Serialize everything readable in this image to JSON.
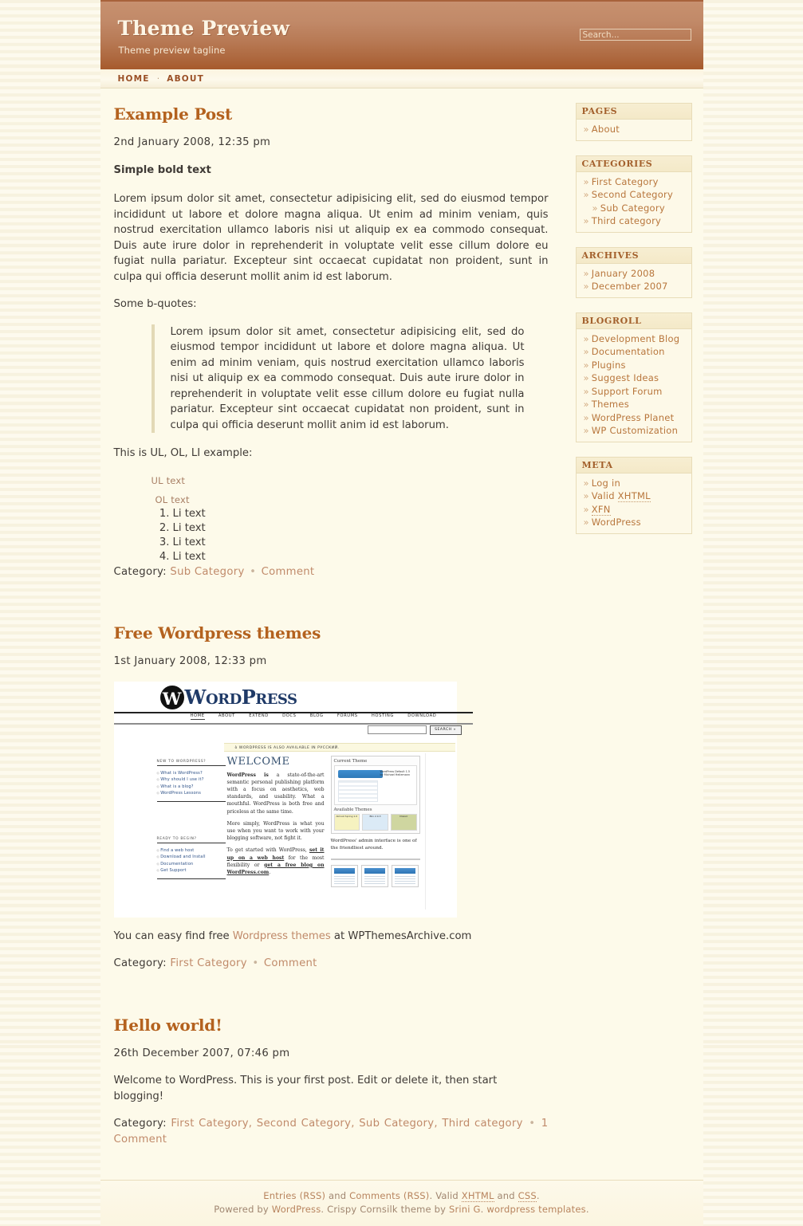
{
  "header": {
    "title": "Theme Preview",
    "tagline": "Theme preview tagline",
    "search_placeholder": "Search..."
  },
  "nav": {
    "items": [
      {
        "label": "HOME"
      },
      {
        "label": "ABOUT"
      }
    ],
    "separator": "·"
  },
  "posts": [
    {
      "title": "Example Post",
      "date": "2nd January 2008, 12:35 pm",
      "bold_text": "Simple bold text",
      "body": "Lorem ipsum dolor sit amet, consectetur adipisicing elit, sed do eiusmod tempor incididunt ut labore et dolore magna aliqua. Ut enim ad minim veniam, quis nostrud exercitation ullamco laboris nisi ut aliquip ex ea commodo consequat. Duis aute irure dolor in reprehenderit in voluptate velit esse cillum dolore eu fugiat nulla pariatur. Excepteur sint occaecat cupidatat non proident, sunt in culpa qui officia deserunt mollit anim id est laborum.",
      "bq_intro": "Some b-quotes:",
      "blockquote": "Lorem ipsum dolor sit amet, consectetur adipisicing elit, sed do eiusmod tempor incididunt ut labore et dolore magna aliqua. Ut enim ad minim veniam, quis nostrud exercitation ullamco laboris nisi ut aliquip ex ea commodo consequat. Duis aute irure dolor in reprehenderit in voluptate velit esse cillum dolore eu fugiat nulla pariatur. Excepteur sint occaecat cupidatat non proident, sunt in culpa qui officia deserunt mollit anim id est laborum.",
      "list_intro": "This is UL, OL, LI example:",
      "ul_text": "UL text",
      "ol_text": "OL text",
      "li_items": [
        "Li text",
        "Li text",
        "Li text",
        "Li text"
      ],
      "meta_prefix": "Category:",
      "meta_categories": "Sub Category",
      "meta_comment": "Comment"
    },
    {
      "title": "Free Wordpress themes",
      "date": "1st January 2008, 12:33 pm",
      "caption_before": "You can easy find free ",
      "caption_link": "Wordpress themes",
      "caption_after": " at WPThemesArchive.com",
      "meta_prefix": "Category:",
      "meta_categories": "First Category",
      "meta_comment": "Comment"
    },
    {
      "title": "Hello world!",
      "date": "26th December 2007, 07:46 pm",
      "body": "Welcome to WordPress. This is your first post. Edit or delete it, then start blogging!",
      "meta_prefix": "Category:",
      "meta_categories": "First Category, Second Category, Sub Category, Third category",
      "meta_comment": "1 Comment"
    }
  ],
  "wp_screenshot": {
    "logo_w": "W",
    "brand_word": "WORDPRESS",
    "nav": [
      "HOME",
      "ABOUT",
      "EXTEND",
      "DOCS",
      "BLOG",
      "FORUMS",
      "HOSTING",
      "DOWNLOAD"
    ],
    "search_button": "SEARCH »",
    "banner": "ò WORDPRESS IS ALSO AVAILABLE IN РУССКИЙ.",
    "left_head_1": "NEW TO WORDPRESS?",
    "left_links_1": [
      "What is WordPress?",
      "Why should I use it?",
      "What is a blog?",
      "WordPress Lessons"
    ],
    "left_head_2": "READY TO BEGIN?",
    "left_links_2": [
      "Find a web host",
      "Download and Install",
      "Documentation",
      "Get Support"
    ],
    "welcome": "WELCOME",
    "para1_bold": "WordPress is",
    "para1_rest": " a state-of-the-art semantic personal publishing platform with a focus on aesthetics, web standards, and usability. What a mouthful. WordPress is both free and priceless at the same time.",
    "para2": "More simply, WordPress is what you use when you want to work with your blogging software, not fight it.",
    "para3_a": "To get started with WordPress, ",
    "para3_link1": "set it up on a web host",
    "para3_b": " for the most flexibility or ",
    "para3_link2": "get a free blog on WordPress.com",
    "para3_c": ".",
    "current_theme": "Current Theme",
    "theme_name": "WordPress Default 1.5 by Michael Heilemann",
    "available_themes": "Available Themes",
    "theme_thumbs": [
      "Almost Spring 1.0",
      "Blix 2.0.3",
      "Classic"
    ],
    "admin_caption": "WordPress' admin interface is one of the friendliest around."
  },
  "sidebar": {
    "widgets": [
      {
        "title": "Pages",
        "items": [
          {
            "label": "About",
            "sub": false
          }
        ]
      },
      {
        "title": "Categories",
        "items": [
          {
            "label": "First Category",
            "sub": false
          },
          {
            "label": "Second Category",
            "sub": false
          },
          {
            "label": "Sub Category",
            "sub": true
          },
          {
            "label": "Third category",
            "sub": false
          }
        ]
      },
      {
        "title": "Archives",
        "items": [
          {
            "label": "January 2008",
            "sub": false
          },
          {
            "label": "December 2007",
            "sub": false
          }
        ]
      },
      {
        "title": "Blogroll",
        "items": [
          {
            "label": "Development Blog",
            "sub": false
          },
          {
            "label": "Documentation",
            "sub": false
          },
          {
            "label": "Plugins",
            "sub": false
          },
          {
            "label": "Suggest Ideas",
            "sub": false
          },
          {
            "label": "Support Forum",
            "sub": false
          },
          {
            "label": "Themes",
            "sub": false
          },
          {
            "label": "WordPress Planet",
            "sub": false
          },
          {
            "label": "WP Customization",
            "sub": false
          }
        ]
      },
      {
        "title": "Meta",
        "items": [
          {
            "label": "Log in",
            "sub": false
          },
          {
            "label": "Valid XHTML",
            "sub": false,
            "abbr": "XHTML",
            "prefix": "Valid "
          },
          {
            "label": "XFN",
            "sub": false,
            "abbr": "XFN",
            "prefix": ""
          },
          {
            "label": "WordPress",
            "sub": false
          }
        ]
      }
    ],
    "arrow": "»"
  },
  "footer": {
    "line1_a": "Entries (RSS)",
    "line1_b": " and ",
    "line1_c": "Comments (RSS)",
    "line1_d": ". Valid ",
    "line1_e": "XHTML",
    "line1_f": " and ",
    "line1_g": "CSS",
    "line1_h": ".",
    "line2_a": "Powered by ",
    "line2_b": "WordPress",
    "line2_c": ". Crispy Cornsilk theme by ",
    "line2_d": "Srini G",
    "line2_e": ". ",
    "line2_f": "wordpress templates",
    "line2_g": "."
  },
  "colors": {
    "header_top": "#c89070",
    "header_bottom": "#a65a2c",
    "heading": "#b4621f",
    "link": "#b8763c",
    "page_bg": "#faf6e6",
    "content_bg": "#fdfaea",
    "widget_border": "#e8dcb8"
  }
}
